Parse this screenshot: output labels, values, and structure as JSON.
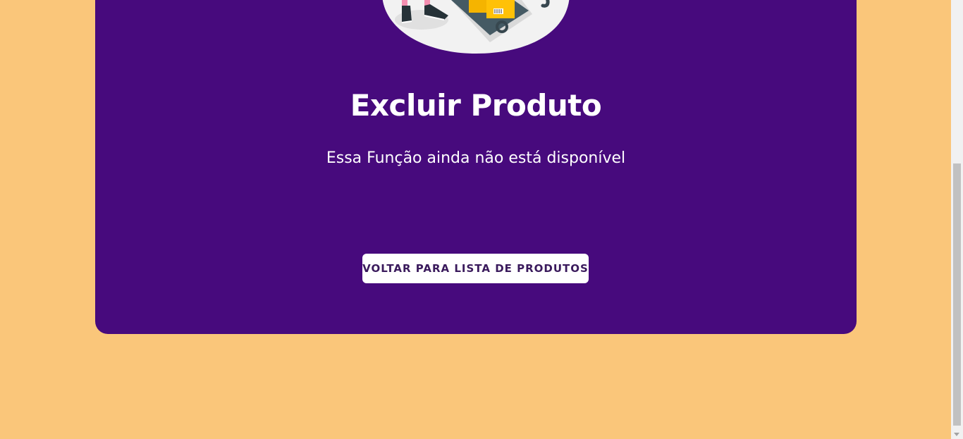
{
  "page": {
    "title": "Excluir Produto",
    "message": "Essa Função ainda não está disponível",
    "back_button_label": "VOLTAR PARA LISTA DE PRODUTOS"
  },
  "colors": {
    "background": "#fac67a",
    "card": "#470a7d",
    "button_bg": "#ffffff",
    "button_text": "#3a1a5c"
  },
  "illustration": {
    "icon": "warehouse-delivery-illustration"
  }
}
